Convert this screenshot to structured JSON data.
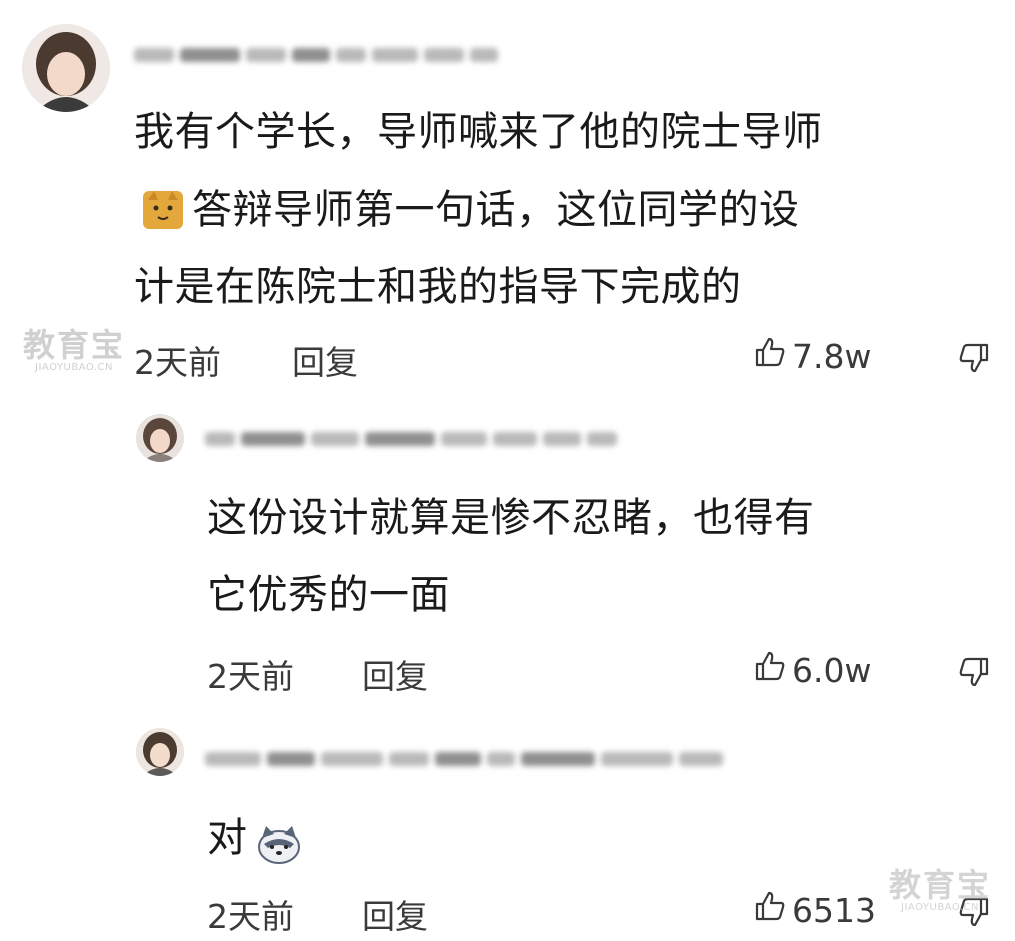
{
  "comments": [
    {
      "text_lines": [
        "我有个学长，导师喊来了他的院士导师",
        "答辩导师第一句话，这位同学的设",
        "计是在陈院士和我的指导下完成的"
      ],
      "time": "2天前",
      "reply": "回复",
      "likes": "7.8w"
    },
    {
      "text_lines": [
        "这份设计就算是惨不忍睹，也得有",
        "它优秀的一面"
      ],
      "time": "2天前",
      "reply": "回复",
      "likes": "6.0w"
    },
    {
      "text_lines": [
        "对"
      ],
      "time": "2天前",
      "reply": "回复",
      "likes": "6513"
    }
  ],
  "watermark": {
    "cn": "教育宝",
    "en": "JIAOYUBAO.CN"
  },
  "icons": {
    "like": "thumbs-up-icon",
    "dislike": "thumbs-down-icon",
    "emoji_1": "cat-emoji-icon",
    "emoji_2": "dog-emoji-icon"
  }
}
